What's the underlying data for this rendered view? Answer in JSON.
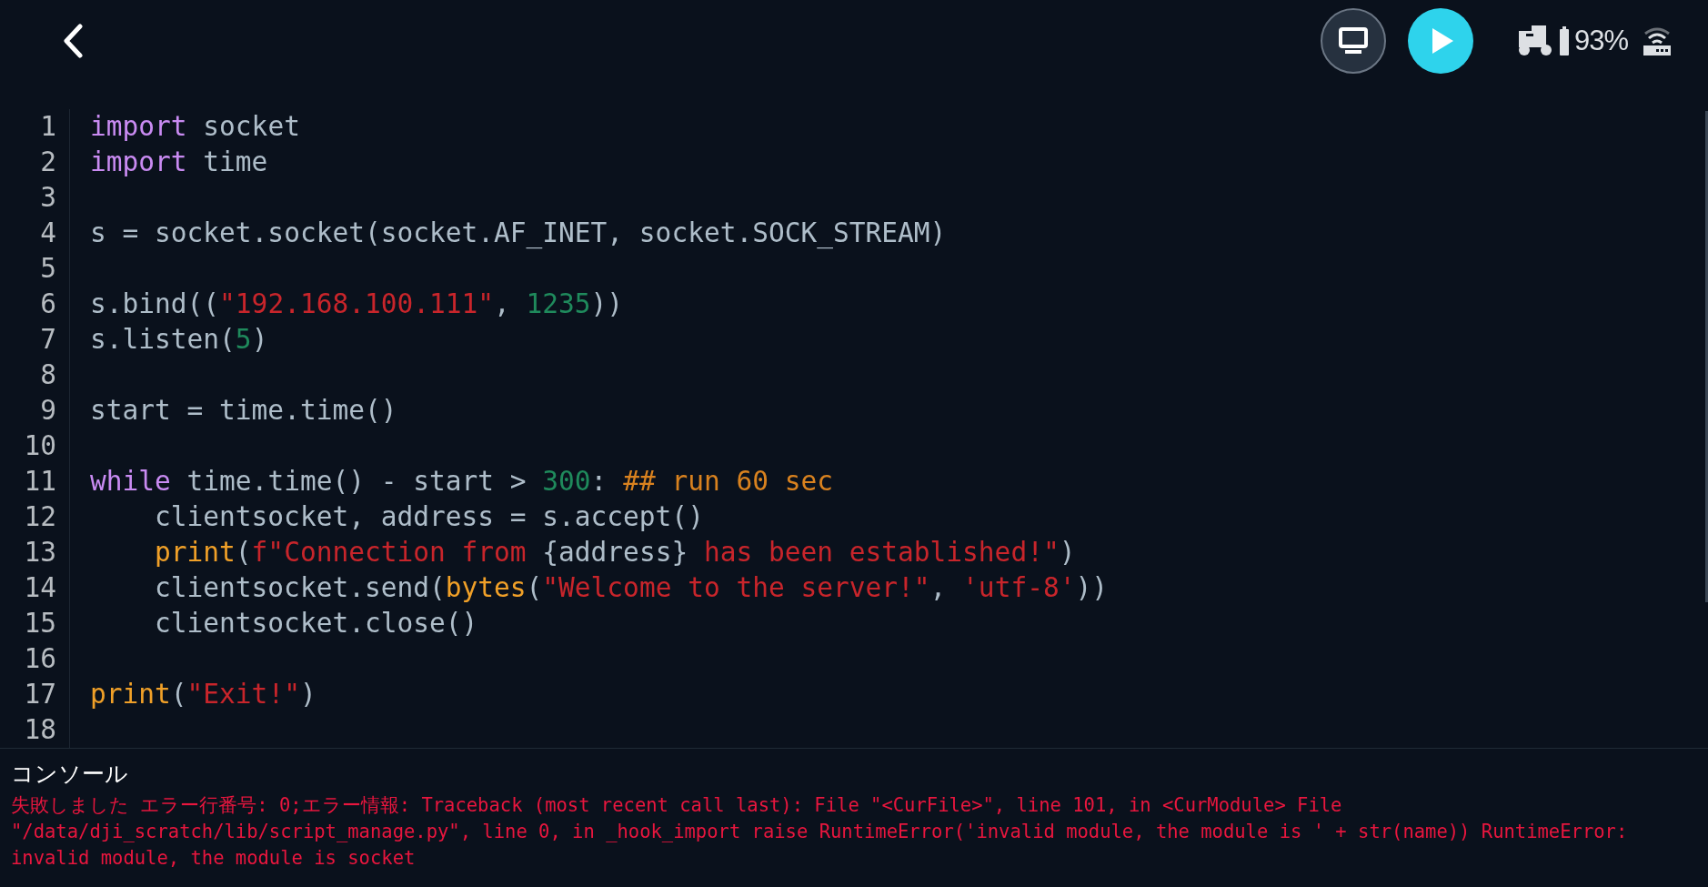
{
  "header": {
    "battery": "93%"
  },
  "editor": {
    "lines": [
      {
        "number": "1",
        "tokens": [
          {
            "kind": "keyword",
            "text": "import"
          },
          {
            "kind": "plain",
            "text": " socket"
          }
        ]
      },
      {
        "number": "2",
        "tokens": [
          {
            "kind": "keyword",
            "text": "import"
          },
          {
            "kind": "plain",
            "text": " time"
          }
        ]
      },
      {
        "number": "3"
      },
      {
        "number": "4",
        "tokens": [
          {
            "kind": "plain",
            "text": "s = socket.socket(socket.AF_INET, socket.SOCK_STREAM)"
          }
        ]
      },
      {
        "number": "5"
      },
      {
        "number": "6",
        "tokens": [
          {
            "kind": "plain",
            "text": "s.bind(("
          },
          {
            "kind": "string",
            "text": "\"192.168.100.111\""
          },
          {
            "kind": "plain",
            "text": ", "
          },
          {
            "kind": "number",
            "text": "1235"
          },
          {
            "kind": "plain",
            "text": "))"
          }
        ]
      },
      {
        "number": "7",
        "tokens": [
          {
            "kind": "plain",
            "text": "s.listen("
          },
          {
            "kind": "number",
            "text": "5"
          },
          {
            "kind": "plain",
            "text": ")"
          }
        ]
      },
      {
        "number": "8"
      },
      {
        "number": "9",
        "tokens": [
          {
            "kind": "plain",
            "text": "start = time.time()"
          }
        ]
      },
      {
        "number": "10"
      },
      {
        "number": "11",
        "tokens": [
          {
            "kind": "keyword",
            "text": "while"
          },
          {
            "kind": "plain",
            "text": " time.time() - start > "
          },
          {
            "kind": "number",
            "text": "300"
          },
          {
            "kind": "plain",
            "text": ": "
          },
          {
            "kind": "comment",
            "text": "## run 60 sec"
          }
        ]
      },
      {
        "number": "12",
        "indent": true,
        "tokens": [
          {
            "kind": "plain",
            "text": "clientsocket, address = s.accept()"
          }
        ]
      },
      {
        "number": "13",
        "indent": true,
        "tokens": [
          {
            "kind": "builtin",
            "text": "print"
          },
          {
            "kind": "plain",
            "text": "("
          },
          {
            "kind": "string",
            "text": "f\"Connection from "
          },
          {
            "kind": "plain",
            "text": "{address}"
          },
          {
            "kind": "string",
            "text": " has been established!\""
          },
          {
            "kind": "plain",
            "text": ")"
          }
        ]
      },
      {
        "number": "14",
        "indent": true,
        "tokens": [
          {
            "kind": "plain",
            "text": "clientsocket.send("
          },
          {
            "kind": "builtin",
            "text": "bytes"
          },
          {
            "kind": "plain",
            "text": "("
          },
          {
            "kind": "string",
            "text": "\"Welcome to the server!\""
          },
          {
            "kind": "plain",
            "text": ", "
          },
          {
            "kind": "string",
            "text": "'utf-8'"
          },
          {
            "kind": "plain",
            "text": "))"
          }
        ]
      },
      {
        "number": "15",
        "indent": true,
        "tokens": [
          {
            "kind": "plain",
            "text": "clientsocket.close()"
          }
        ]
      },
      {
        "number": "16"
      },
      {
        "number": "17",
        "tokens": [
          {
            "kind": "builtin",
            "text": "print"
          },
          {
            "kind": "plain",
            "text": "("
          },
          {
            "kind": "string",
            "text": "\"Exit!\""
          },
          {
            "kind": "plain",
            "text": ")"
          }
        ]
      },
      {
        "number": "18"
      }
    ]
  },
  "console": {
    "title": "コンソール",
    "output": "失敗しました エラー行番号: 0;エラー情報: Traceback (most recent call last): File \"<CurFile>\", line 101, in <CurModule> File \"/data/dji_scratch/lib/script_manage.py\", line 0, in _hook_import raise RuntimeError('invalid module, the module is ' + str(name)) RuntimeError: invalid module, the module is socket"
  }
}
